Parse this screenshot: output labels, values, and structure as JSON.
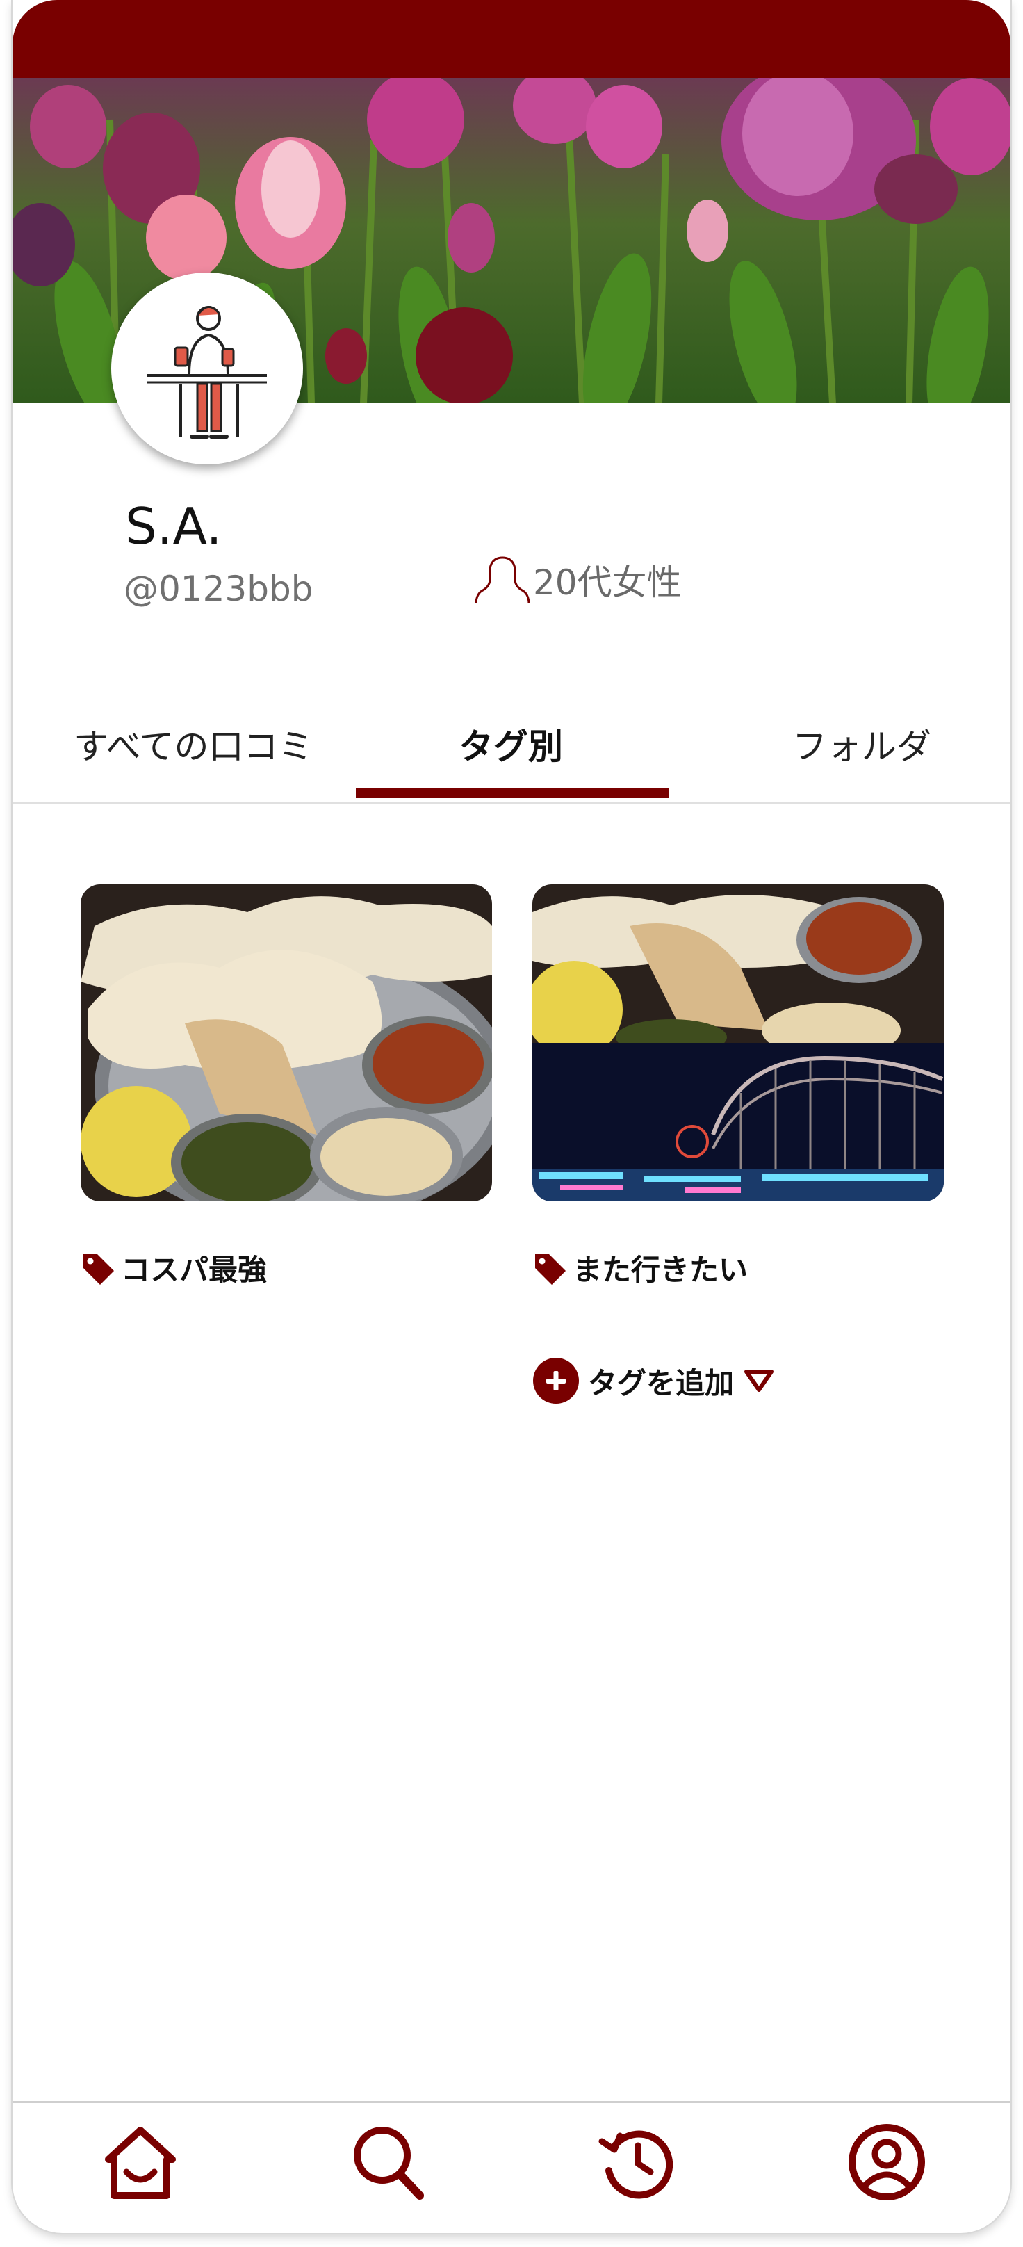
{
  "profile": {
    "name": "S.A.",
    "handle": "@0123bbb",
    "demographic": "20代女性"
  },
  "tabs": [
    {
      "label": "すべての口コミ",
      "active": false
    },
    {
      "label": "タグ別",
      "active": true
    },
    {
      "label": "フォルダ",
      "active": false
    }
  ],
  "tag_cards": [
    {
      "label": "コスパ最強"
    },
    {
      "label": "また行きたい"
    }
  ],
  "add_tag": {
    "label": "タグを追加"
  },
  "bottom_nav": [
    {
      "icon": "home-icon"
    },
    {
      "icon": "search-icon"
    },
    {
      "icon": "history-icon"
    },
    {
      "icon": "profile-icon"
    }
  ],
  "colors": {
    "accent": "#790000"
  }
}
